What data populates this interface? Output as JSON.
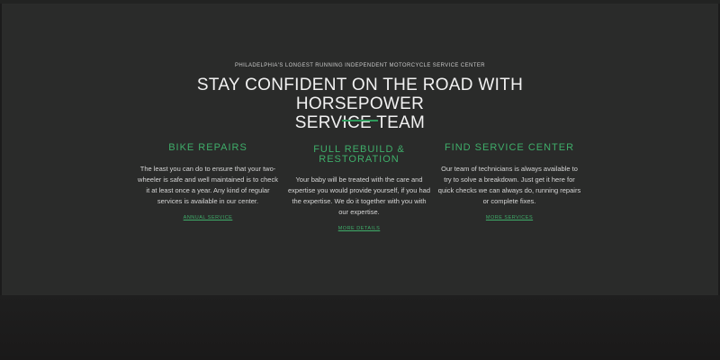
{
  "hero": {
    "kicker": "PHILADELPHIA'S LONGEST RUNNING INDEPENDENT MOTORCYCLE SERVICE CENTER",
    "title_line1": "STAY CONFIDENT ON THE ROAD WITH HORSEPOWER",
    "title_line2": "SERVICE TEAM",
    "accent_color": "#3fae6a"
  },
  "services": [
    {
      "title": "BIKE REPAIRS",
      "title_line2": "",
      "text": "The least you can do to ensure that your two-wheeler is safe and well maintained is to check it at least once a year. Any kind of regular services is available in our center.",
      "link": "ANNUAL SERVICE"
    },
    {
      "title": "FULL REBUILD &",
      "title_line2": "RESTORATION",
      "text": "Your baby will be treated with the care and expertise you would provide yourself, if you had the expertise. We do it together with you with our expertise.",
      "link": "MORE DETAILS"
    },
    {
      "title": "FIND SERVICE CENTER",
      "title_line2": "",
      "text": "Our team of technicians is always available to try to solve a breakdown. Just get it here for quick checks we can always do, running repairs or complete fixes.",
      "link": "MORE SERVICES"
    }
  ]
}
